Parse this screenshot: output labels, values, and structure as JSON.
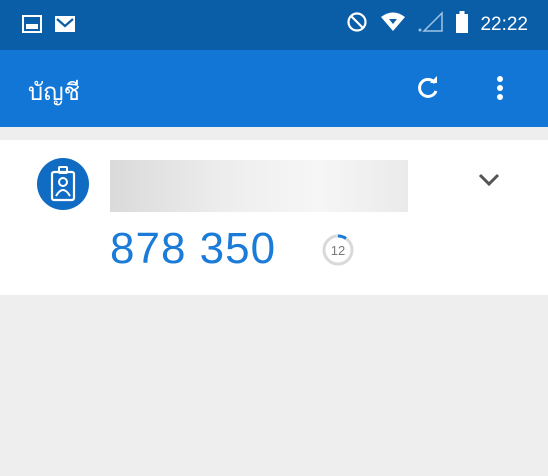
{
  "status_bar": {
    "time": "22:22",
    "icons": [
      "image-icon",
      "mail-icon",
      "do-not-disturb-icon",
      "wifi-icon",
      "signal-icon",
      "battery-icon"
    ]
  },
  "app_bar": {
    "title": "บัญชี",
    "actions": [
      "refresh-icon",
      "more-vert-icon"
    ],
    "color": "#1176d6"
  },
  "account": {
    "avatar_icon": "id-badge-icon",
    "code": "878 350",
    "seconds_remaining": "12",
    "expand_icon": "chevron-down-icon",
    "code_color": "#1a7bd8"
  }
}
